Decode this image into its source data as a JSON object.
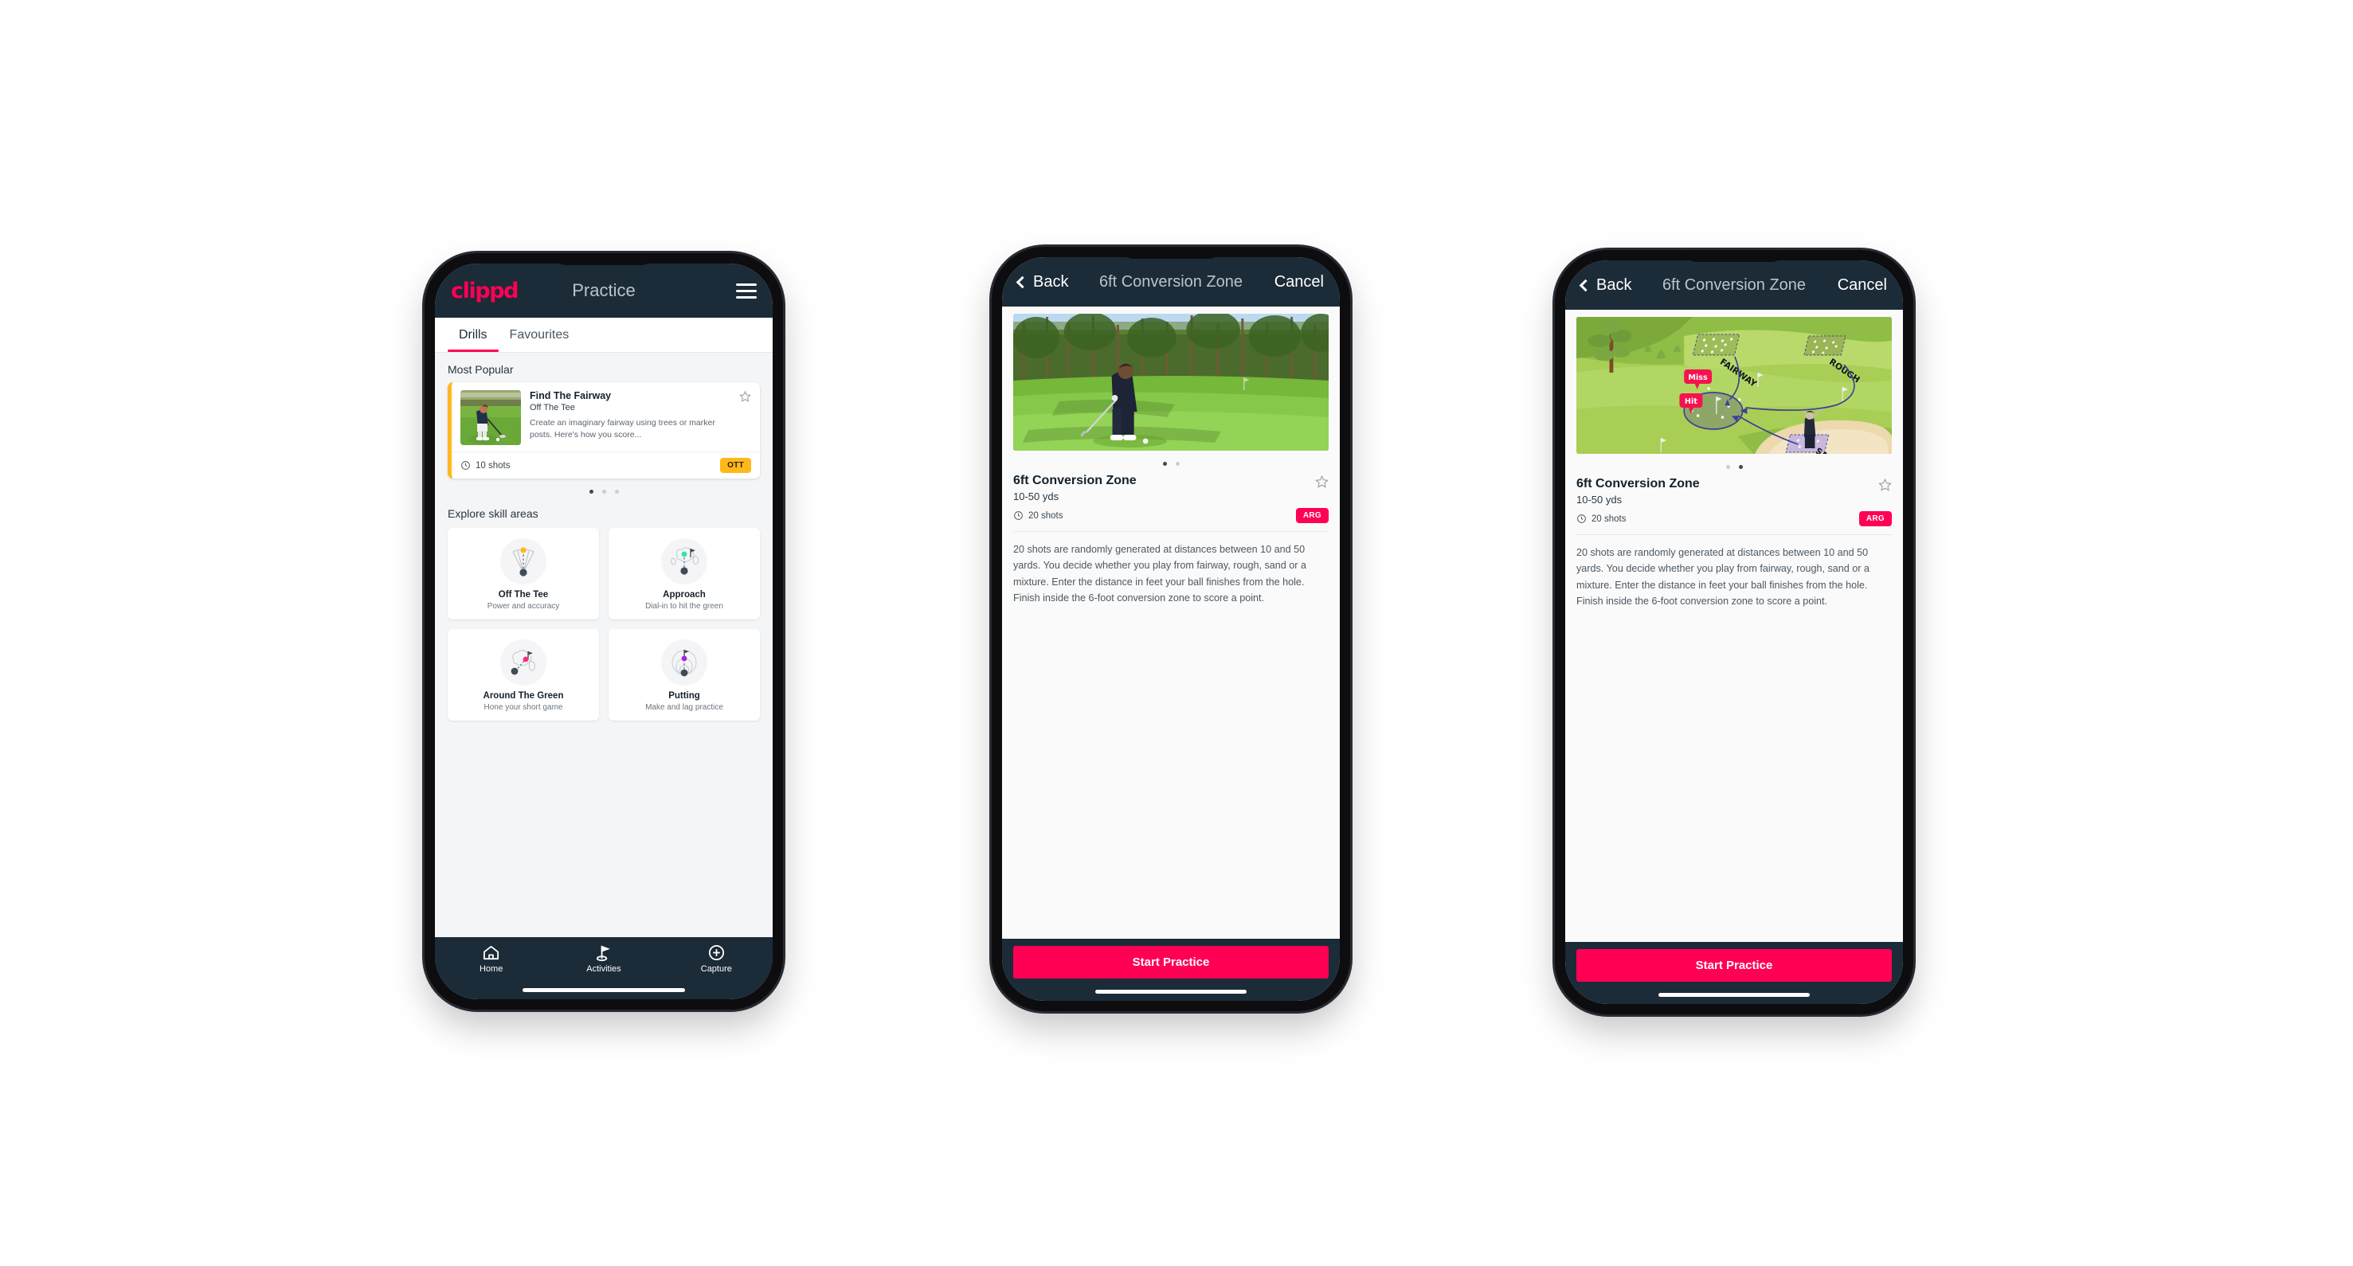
{
  "app": {
    "brand": "clippd",
    "brand_color": "#FF0055",
    "header_bg": "#1B2B38"
  },
  "phone1": {
    "header": {
      "title": "Practice",
      "menu_icon": "hamburger-menu-icon"
    },
    "tabs": [
      {
        "label": "Drills",
        "active": true
      },
      {
        "label": "Favourites",
        "active": false
      }
    ],
    "most_popular": {
      "heading": "Most Popular",
      "card": {
        "title": "Find The Fairway",
        "subtitle": "Off The Tee",
        "description": "Create an imaginary fairway using trees or marker posts. Here's how you score...",
        "shots": "10 shots",
        "badge": "OTT",
        "badge_color": "#FFB81C",
        "accent_color": "#FFB81C",
        "next_card_accent": "#4FE0C0",
        "favourite_icon": "star-outline-icon",
        "clock_icon": "clock-icon"
      },
      "pager": {
        "count": 3,
        "active": 0
      }
    },
    "explore": {
      "heading": "Explore skill areas",
      "items": [
        {
          "title": "Off The Tee",
          "subtitle": "Power and accuracy",
          "icon": "tee-dispersion-icon",
          "dot_color": "#FFB81C"
        },
        {
          "title": "Approach",
          "subtitle": "Dial-in to hit the green",
          "icon": "green-approach-icon",
          "dot_color": "#2EE6B0"
        },
        {
          "title": "Around The Green",
          "subtitle": "Hone your short game",
          "icon": "chip-around-green-icon",
          "dot_color": "#FF2D78"
        },
        {
          "title": "Putting",
          "subtitle": "Make and lag practice",
          "icon": "putting-rings-icon",
          "dot_color": "#A626D9"
        }
      ]
    },
    "tabbar": [
      {
        "label": "Home",
        "icon": "home-icon",
        "active": false
      },
      {
        "label": "Activities",
        "icon": "golf-flag-icon",
        "active": true
      },
      {
        "label": "Capture",
        "icon": "plus-circle-icon",
        "active": false
      }
    ]
  },
  "phone2": {
    "nav": {
      "back": "Back",
      "title": "6ft Conversion Zone",
      "cancel": "Cancel",
      "back_icon": "chevron-left-icon"
    },
    "hero": {
      "kind": "photo",
      "alt": "golfer-chipping-photo"
    },
    "pager": {
      "count": 2,
      "active": 0
    },
    "detail": {
      "title": "6ft Conversion Zone",
      "subtitle": "10-50 yds",
      "shots": "20 shots",
      "badge": "ARG",
      "badge_color": "#FF0055",
      "favourite_icon": "star-outline-icon",
      "clock_icon": "clock-icon",
      "body": "20 shots are randomly generated at distances between 10 and 50 yards. You decide whether you play from fairway, rough, sand or a mixture. Enter the distance in feet your ball finishes from the hole. Finish inside the 6-foot conversion zone to score a point."
    },
    "cta": "Start Practice"
  },
  "phone3": {
    "nav": {
      "back": "Back",
      "title": "6ft Conversion Zone",
      "cancel": "Cancel",
      "back_icon": "chevron-left-icon"
    },
    "hero": {
      "kind": "illustration",
      "alt": "golf-course-diagram",
      "labels": {
        "fairway": "FAIRWAY",
        "rough": "ROUGH",
        "sand": "SAND",
        "miss": "Miss",
        "hit": "Hit"
      }
    },
    "pager": {
      "count": 2,
      "active": 1
    },
    "detail": {
      "title": "6ft Conversion Zone",
      "subtitle": "10-50 yds",
      "shots": "20 shots",
      "badge": "ARG",
      "badge_color": "#FF0055",
      "favourite_icon": "star-outline-icon",
      "clock_icon": "clock-icon",
      "body": "20 shots are randomly generated at distances between 10 and 50 yards. You decide whether you play from fairway, rough, sand or a mixture. Enter the distance in feet your ball finishes from the hole. Finish inside the 6-foot conversion zone to score a point."
    },
    "cta": "Start Practice"
  }
}
